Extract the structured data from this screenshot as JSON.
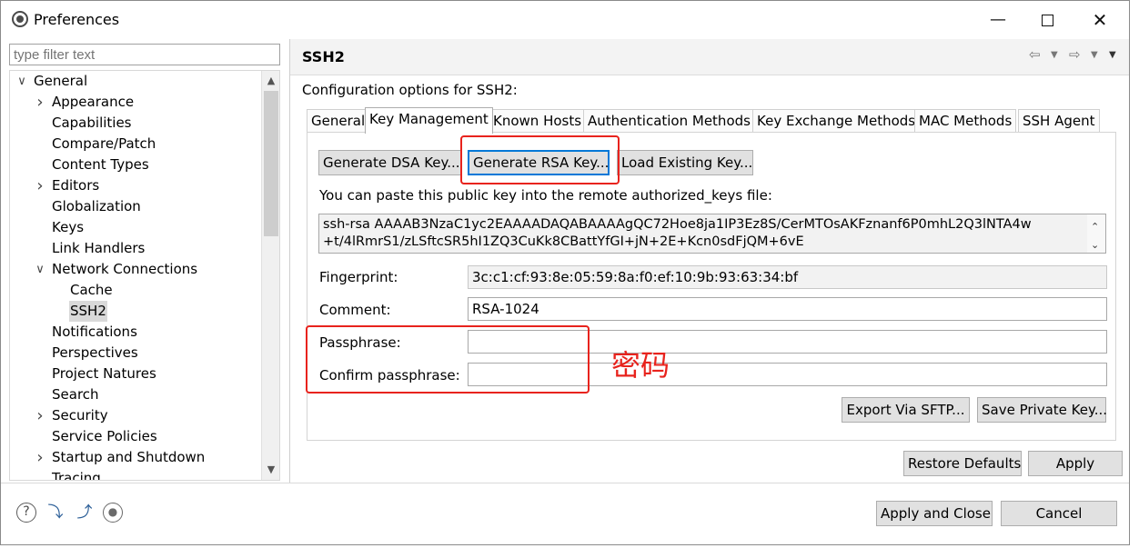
{
  "window": {
    "title": "Preferences"
  },
  "tree": {
    "filter_placeholder": "type filter text",
    "items": [
      {
        "label": "General",
        "level": 0,
        "twisty": "open"
      },
      {
        "label": "Appearance",
        "level": 1,
        "twisty": "closed"
      },
      {
        "label": "Capabilities",
        "level": 1,
        "twisty": "none"
      },
      {
        "label": "Compare/Patch",
        "level": 1,
        "twisty": "none"
      },
      {
        "label": "Content Types",
        "level": 1,
        "twisty": "none"
      },
      {
        "label": "Editors",
        "level": 1,
        "twisty": "closed"
      },
      {
        "label": "Globalization",
        "level": 1,
        "twisty": "none"
      },
      {
        "label": "Keys",
        "level": 1,
        "twisty": "none"
      },
      {
        "label": "Link Handlers",
        "level": 1,
        "twisty": "none"
      },
      {
        "label": "Network Connections",
        "level": 1,
        "twisty": "open"
      },
      {
        "label": "Cache",
        "level": 2,
        "twisty": "none"
      },
      {
        "label": "SSH2",
        "level": 2,
        "twisty": "none",
        "selected": true
      },
      {
        "label": "Notifications",
        "level": 1,
        "twisty": "none"
      },
      {
        "label": "Perspectives",
        "level": 1,
        "twisty": "none"
      },
      {
        "label": "Project Natures",
        "level": 1,
        "twisty": "none"
      },
      {
        "label": "Search",
        "level": 1,
        "twisty": "none"
      },
      {
        "label": "Security",
        "level": 1,
        "twisty": "closed"
      },
      {
        "label": "Service Policies",
        "level": 1,
        "twisty": "none"
      },
      {
        "label": "Startup and Shutdown",
        "level": 1,
        "twisty": "closed"
      },
      {
        "label": "Tracing",
        "level": 1,
        "twisty": "none"
      }
    ]
  },
  "page": {
    "title": "SSH2",
    "description": "Configuration options for SSH2:"
  },
  "tabs": [
    "General",
    "Key Management",
    "Known Hosts",
    "Authentication Methods",
    "Key Exchange Methods",
    "MAC Methods",
    "SSH Agent"
  ],
  "active_tab": "Key Management",
  "keymgmt": {
    "gen_dsa": "Generate DSA Key...",
    "gen_rsa": "Generate RSA Key...",
    "load_key": "Load Existing Key...",
    "paste_hint": "You can paste this public key into the remote authorized_keys file:",
    "public_key_line1": "ssh-rsa AAAAB3NzaC1yc2EAAAADAQABAAAAgQC72Hoe8ja1IP3Ez8S/CerMTOsAKFznanf6P0mhL2Q3lNTA4w",
    "public_key_line2": "+t/4lRmrS1/zLSftcSR5hI1ZQ3CuKk8CBattYfGI+jN+2E+Kcn0sdFjQM+6vE",
    "fingerprint_label": "Fingerprint:",
    "fingerprint": "3c:c1:cf:93:8e:05:59:8a:f0:ef:10:9b:93:63:34:bf",
    "comment_label": "Comment:",
    "comment": "RSA-1024",
    "passphrase_label": "Passphrase:",
    "passphrase": "",
    "confirm_label": "Confirm passphrase:",
    "confirm": "",
    "export_sftp": "Export Via SFTP...",
    "save_private": "Save Private Key..."
  },
  "annotation": {
    "text": "密码",
    "color": "#e8231d"
  },
  "page_buttons": {
    "restore": "Restore Defaults",
    "apply": "Apply"
  },
  "footer": {
    "apply_close": "Apply and Close",
    "cancel": "Cancel",
    "icons": [
      "help-icon",
      "import-icon",
      "export-icon",
      "record-icon"
    ]
  },
  "colors": {
    "focus": "#0078d7",
    "selection": "#d9d9d9"
  }
}
